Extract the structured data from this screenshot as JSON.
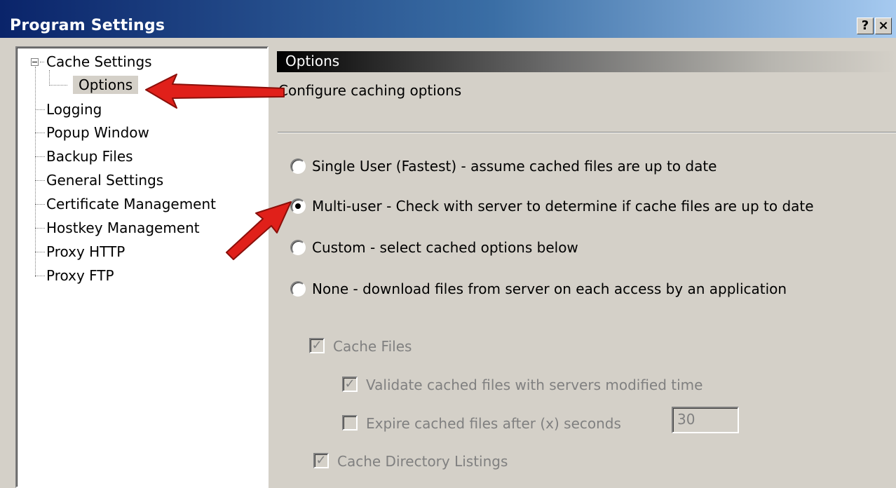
{
  "window": {
    "title": "Program Settings",
    "help_label": "?",
    "close_label": "×"
  },
  "tree": {
    "items": [
      {
        "label": "Cache Settings"
      },
      {
        "label": "Options"
      },
      {
        "label": "Logging"
      },
      {
        "label": "Popup Window"
      },
      {
        "label": "Backup Files"
      },
      {
        "label": "General Settings"
      },
      {
        "label": "Certificate Management"
      },
      {
        "label": "Hostkey Management"
      },
      {
        "label": "Proxy HTTP"
      },
      {
        "label": "Proxy FTP"
      }
    ]
  },
  "panel": {
    "header": "Options",
    "description": "Configure caching options",
    "radios": [
      {
        "label": "Single User (Fastest) - assume cached files are up to date",
        "checked": false
      },
      {
        "label": "Multi-user - Check with server to determine if cache files are up to date",
        "checked": true
      },
      {
        "label": "Custom - select cached options below",
        "checked": false
      },
      {
        "label": "None - download files from server on each access by an application",
        "checked": false
      }
    ],
    "checkboxes": [
      {
        "label": "Cache Files",
        "checked": true
      },
      {
        "label": "Validate cached files with servers modified time",
        "checked": true
      },
      {
        "label": "Expire cached files after (x) seconds",
        "checked": false
      },
      {
        "label": "Cache Directory Listings",
        "checked": true
      }
    ],
    "expire_seconds": "30"
  },
  "colors": {
    "title_bar_start": "#0a246a",
    "title_bar_end": "#a6caf0",
    "annotation_arrow": "#e0201a",
    "dialog_face": "#d4d0c8"
  },
  "icons": {
    "check": "✓",
    "expander": "minus-box"
  }
}
